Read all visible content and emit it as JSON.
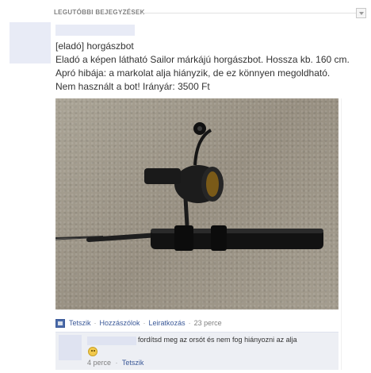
{
  "section": {
    "title": "LEGUTÓBBI BEJEGYZÉSEK"
  },
  "post": {
    "title": "[eladó] horgászbot",
    "lines": [
      "Eladó a képen látható Sailor márkájú horgászbot. Hossza kb. 160 cm.",
      "Apró hibája: a markolat alja hiányzik, de ez könnyen megoldható.",
      "Nem használt a bot! Irányár: 3500 Ft"
    ]
  },
  "actions": {
    "like": "Tetszik",
    "comment": "Hozzászólok",
    "unsubscribe": "Leiratkozás",
    "separator": "·",
    "time": "23 perce"
  },
  "comment": {
    "text": "fordítsd meg az orsót és nem fog hiányozni az alja",
    "time": "4 perce",
    "separator": "·",
    "like": "Tetszik"
  },
  "icons": {
    "post_type": "note-icon",
    "emoji": "smiley-icon",
    "scroll": "chevron-down-icon"
  }
}
